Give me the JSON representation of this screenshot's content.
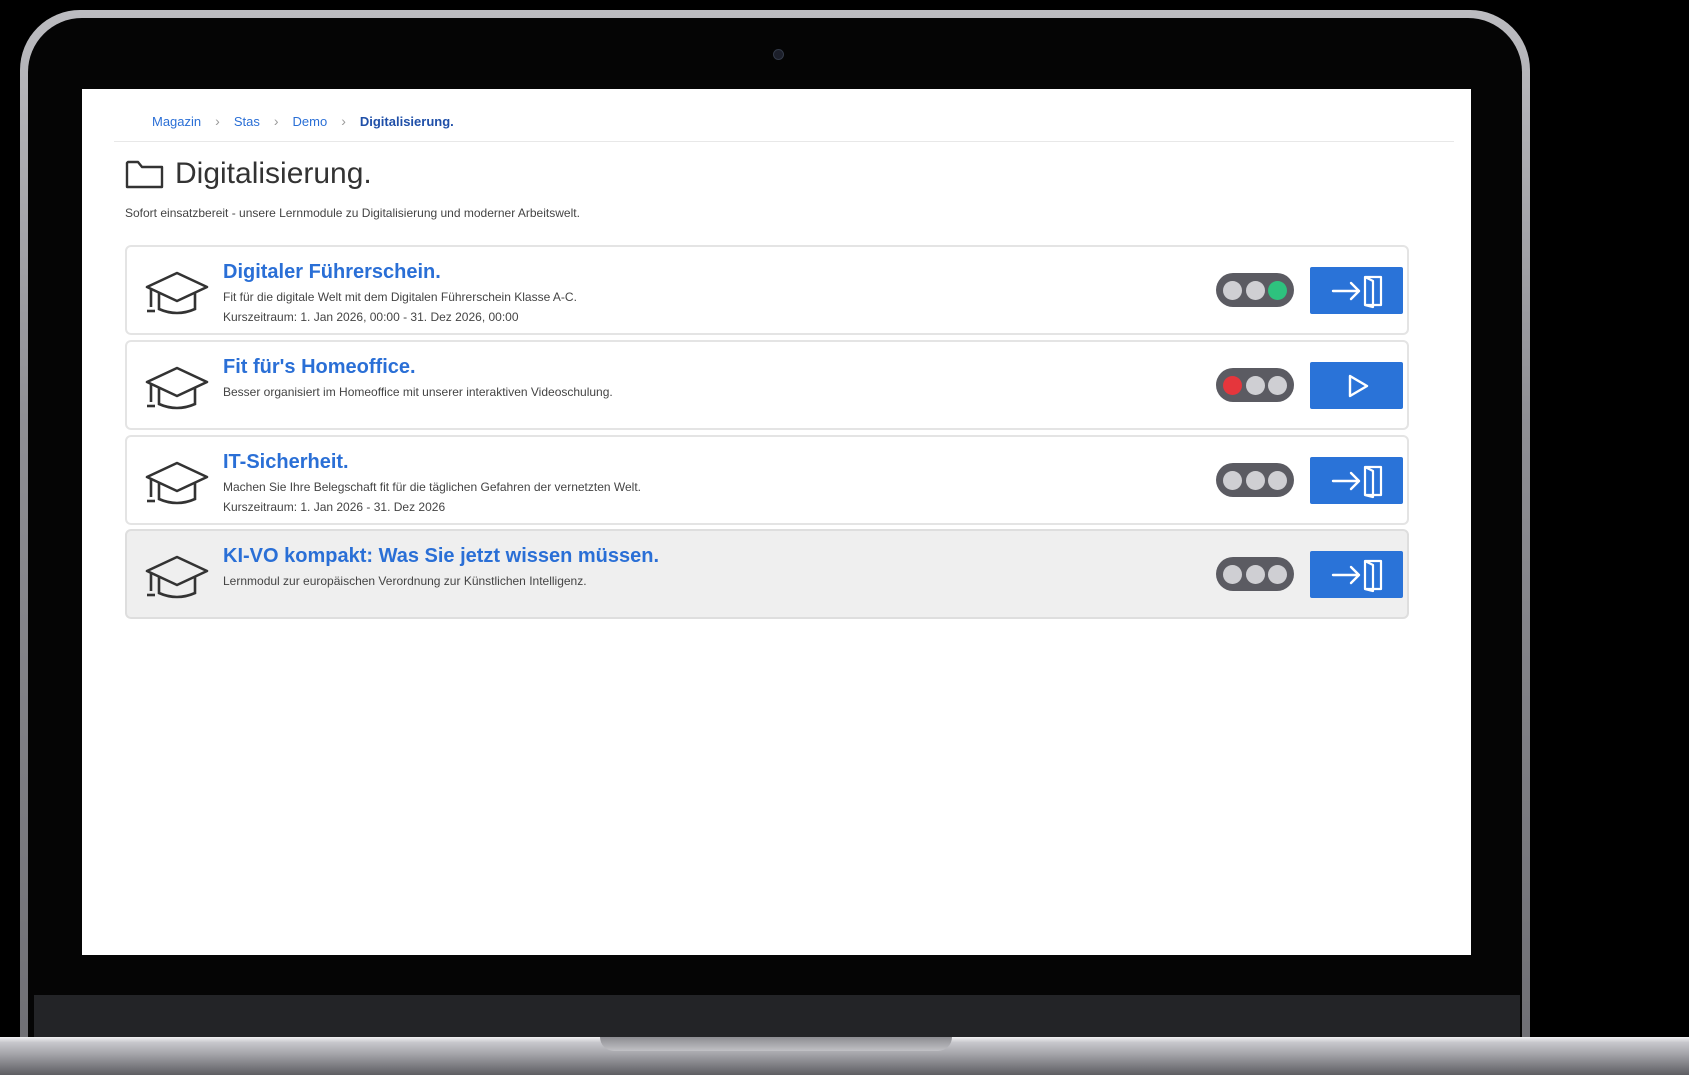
{
  "breadcrumb": {
    "items": [
      "Magazin",
      "Stas",
      "Demo"
    ],
    "current": "Digitalisierung."
  },
  "page": {
    "title": "Digitalisierung.",
    "subtitle": "Sofort einsatzbereit - unsere Lernmodule zu Digitalisierung und moderner Arbeitswelt.",
    "icon": "folder-icon"
  },
  "courses": [
    {
      "title": "Digitaler Führerschein.",
      "description": "Fit für die digitale Welt mit dem Digitalen Führerschein Klasse A-C.",
      "period": "Kurszeitraum: 1. Jan 2026, 00:00 - 31. Dez 2026, 00:00",
      "status": "green",
      "action_icon": "enter-icon"
    },
    {
      "title": "Fit für's Homeoffice.",
      "description": "Besser organisiert im Homeoffice mit unserer interaktiven Videoschulung.",
      "period": "",
      "status": "red",
      "action_icon": "play-icon"
    },
    {
      "title": "IT-Sicherheit.",
      "description": "Machen Sie Ihre Belegschaft fit für die täglichen Gefahren der vernetzten Welt.",
      "period": "Kurszeitraum: 1. Jan 2026 - 31. Dez 2026",
      "status": "none",
      "action_icon": "enter-icon"
    },
    {
      "title": "KI-VO kompakt: Was Sie jetzt wissen müssen.",
      "description": "Lernmodul zur europäischen Verordnung zur Künstlichen Intelligenz.",
      "period": "",
      "status": "none",
      "action_icon": "enter-icon"
    }
  ],
  "colors": {
    "accent": "#2a73d8",
    "link": "#2a6fd6",
    "status_green": "#2ec27e",
    "status_red": "#e5363c",
    "status_off": "#cfcfd3",
    "toggle_body": "#5b5b62"
  }
}
